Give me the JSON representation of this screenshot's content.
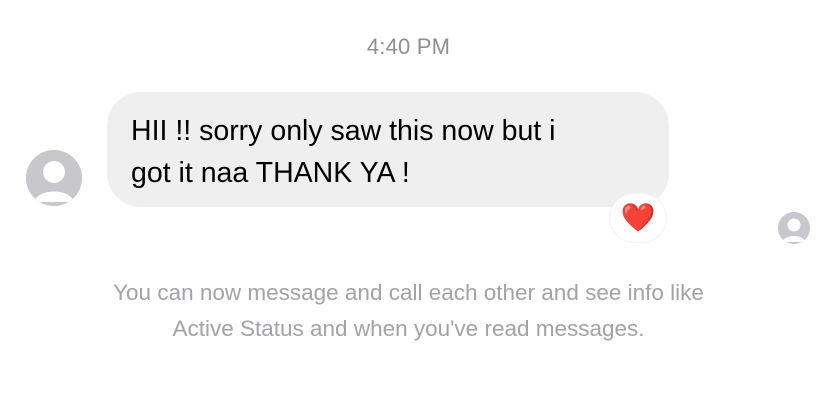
{
  "conversation": {
    "timestamp": "4:40 PM",
    "message": {
      "text": "HII !! sorry only saw this now but i\ngot it naa THANK YA !",
      "reaction": "❤️"
    },
    "notice": "You can now message and call each other and see info like\nActive Status and when you've read messages."
  },
  "colors": {
    "bubble_background": "#efeff0",
    "avatar_placeholder": "#c7c7cc",
    "secondary_text": "#8e8e93",
    "heart": "#e0242e"
  },
  "icons": {
    "sender_avatar": "user-silhouette-icon",
    "read_receipt": "user-silhouette-icon",
    "reaction": "heart-icon"
  }
}
